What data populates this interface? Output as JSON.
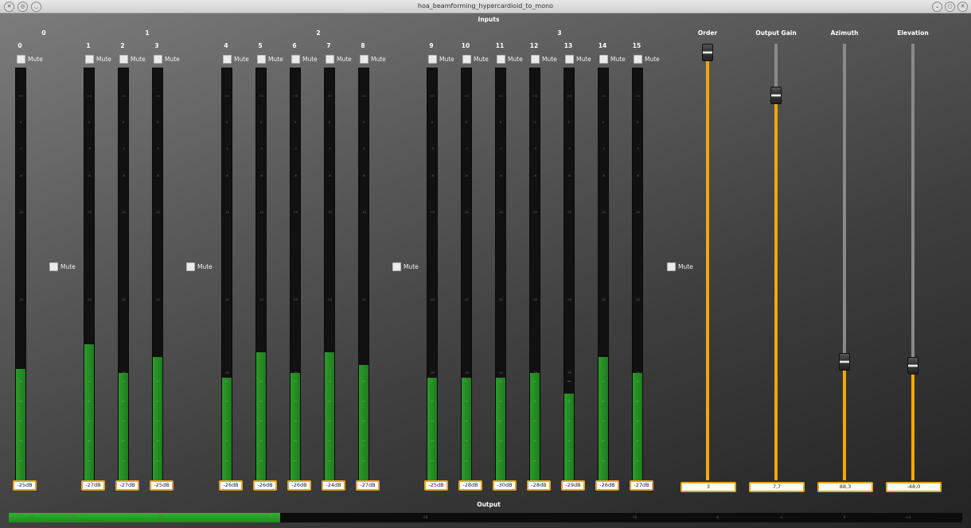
{
  "window": {
    "title": "hoa_beamforming_hypercardioid_to_mono"
  },
  "inputs": {
    "title": "Inputs",
    "order_labels": [
      "0",
      "1",
      "2",
      "3"
    ],
    "order_mute": "Mute",
    "channels": [
      {
        "label": "0",
        "mute": "Mute",
        "level_db": "-25dB",
        "level_fraction": 0.27
      },
      {
        "label": "1",
        "mute": "Mute",
        "level_db": "-27dB",
        "level_fraction": 0.33
      },
      {
        "label": "2",
        "mute": "Mute",
        "level_db": "-27dB",
        "level_fraction": 0.26
      },
      {
        "label": "3",
        "mute": "Mute",
        "level_db": "-25dB",
        "level_fraction": 0.3
      },
      {
        "label": "4",
        "mute": "Mute",
        "level_db": "-26dB",
        "level_fraction": 0.25
      },
      {
        "label": "5",
        "mute": "Mute",
        "level_db": "-26dB",
        "level_fraction": 0.31
      },
      {
        "label": "6",
        "mute": "Mute",
        "level_db": "-26dB",
        "level_fraction": 0.26
      },
      {
        "label": "7",
        "mute": "Mute",
        "level_db": "-24dB",
        "level_fraction": 0.31
      },
      {
        "label": "8",
        "mute": "Mute",
        "level_db": "-27dB",
        "level_fraction": 0.28
      },
      {
        "label": "9",
        "mute": "Mute",
        "level_db": "-25dB",
        "level_fraction": 0.25
      },
      {
        "label": "10",
        "mute": "Mute",
        "level_db": "-28dB",
        "level_fraction": 0.25
      },
      {
        "label": "11",
        "mute": "Mute",
        "level_db": "-30dB",
        "level_fraction": 0.25
      },
      {
        "label": "12",
        "mute": "Mute",
        "level_db": "-28dB",
        "level_fraction": 0.26
      },
      {
        "label": "13",
        "mute": "Mute",
        "level_db": "-29dB",
        "level_fraction": 0.21
      },
      {
        "label": "14",
        "mute": "Mute",
        "level_db": "-26dB",
        "level_fraction": 0.3
      },
      {
        "label": "15",
        "mute": "Mute",
        "level_db": "-27dB",
        "level_fraction": 0.26
      }
    ],
    "meter_ticks": [
      "+3",
      "0",
      "-3",
      "-6",
      "-10",
      "-20",
      "-30"
    ]
  },
  "controls": [
    {
      "label": "Order",
      "value": "3",
      "fraction": 1.0
    },
    {
      "label": "Output Gain",
      "value": "7,7",
      "fraction": 0.88
    },
    {
      "label": "Azimuth",
      "value": "88,3",
      "fraction": 0.27
    },
    {
      "label": "Elevation",
      "value": "-48,0",
      "fraction": 0.26
    }
  ],
  "output": {
    "title": "Output",
    "level_fraction": 0.285,
    "ticks": [
      "-60",
      "-50",
      "-40",
      "-30",
      "-20",
      "-10",
      "-6",
      "-3",
      "0",
      "+3"
    ]
  },
  "colors": {
    "meter_green": "#2c9b2a",
    "slider_orange": "#f0a80a",
    "value_border": "#e5a51e"
  }
}
